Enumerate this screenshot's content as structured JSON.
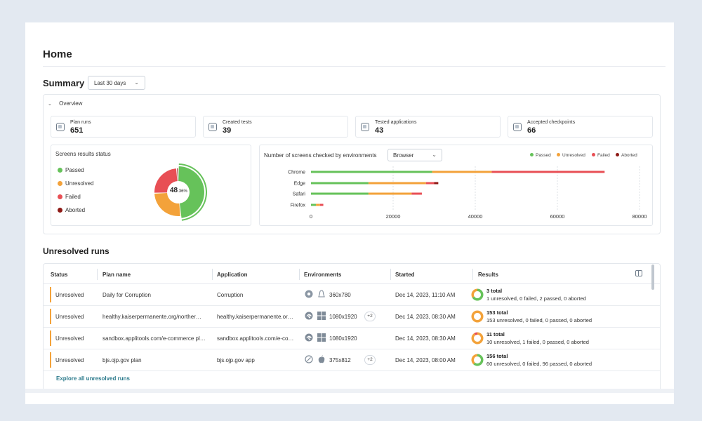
{
  "page": {
    "title": "Home"
  },
  "summary": {
    "title": "Summary",
    "range": "Last 30 days",
    "overview_label": "Overview",
    "stats": [
      {
        "label": "Plan runs",
        "value": "651",
        "icon": "plan-runs-icon"
      },
      {
        "label": "Created tests",
        "value": "39",
        "icon": "tests-icon"
      },
      {
        "label": "Tested applications",
        "value": "43",
        "icon": "grid-icon"
      },
      {
        "label": "Accepted checkpoints",
        "value": "66",
        "icon": "checkpoint-icon"
      }
    ],
    "screens_status": {
      "title": "Screens results status",
      "legend": [
        {
          "label": "Passed",
          "color": "#66c25a"
        },
        {
          "label": "Unresolved",
          "color": "#f3a23a"
        },
        {
          "label": "Failed",
          "color": "#e84f55"
        },
        {
          "label": "Aborted",
          "color": "#8e1a16"
        }
      ],
      "center_value": "48",
      "center_decimal": ".36%",
      "donut": [
        {
          "status": "Passed",
          "fraction": 0.4836
        },
        {
          "status": "Unresolved",
          "fraction": 0.26
        },
        {
          "status": "Failed",
          "fraction": 0.245
        },
        {
          "status": "Aborted",
          "fraction": 0.0114
        }
      ]
    },
    "environments": {
      "title": "Number of screens checked by environments",
      "filter": "Browser",
      "legend": [
        {
          "label": "Passed",
          "color": "#66c25a"
        },
        {
          "label": "Unresolved",
          "color": "#f3a23a"
        },
        {
          "label": "Failed",
          "color": "#e84f55"
        },
        {
          "label": "Aborted",
          "color": "#8e1a16"
        }
      ]
    }
  },
  "chart_data": {
    "type": "bar",
    "orientation": "horizontal",
    "stacked": true,
    "categories": [
      "Chrome",
      "Edge",
      "Safari",
      "Firefox"
    ],
    "series": [
      {
        "name": "Passed",
        "color": "#66c25a",
        "values": [
          29500,
          14000,
          14000,
          1200
        ]
      },
      {
        "name": "Unresolved",
        "color": "#f3a23a",
        "values": [
          14500,
          14000,
          10500,
          1000
        ]
      },
      {
        "name": "Failed",
        "color": "#e84f55",
        "values": [
          27500,
          2000,
          2500,
          800
        ]
      },
      {
        "name": "Aborted",
        "color": "#8e1a16",
        "values": [
          0,
          1000,
          0,
          0
        ]
      }
    ],
    "xlim": [
      0,
      80000
    ],
    "xticks": [
      "0",
      "20000",
      "40000",
      "60000",
      "80000"
    ],
    "grid": true,
    "legend": "top-right"
  },
  "unresolved": {
    "title": "Unresolved runs",
    "columns": [
      "Status",
      "Plan name",
      "Application",
      "Environments",
      "Started",
      "Results"
    ],
    "rows": [
      {
        "status": "Unresolved",
        "plan": "Daily for Corruption",
        "app": "Corruption",
        "env_icons": [
          "chrome-icon",
          "linux-icon"
        ],
        "resolution": "360x780",
        "extra": "",
        "started": "Dec 14, 2023, 11:10 AM",
        "total": "3 total",
        "detail": "1 unresolved, 0 failed, 2 passed, 0 aborted",
        "ring": {
          "passed": 2,
          "unresolved": 1,
          "failed": 0,
          "aborted": 0
        }
      },
      {
        "status": "Unresolved",
        "plan": "healthy.kaiserpermanente.org/norther…",
        "app": "healthy.kaiserpermanente.or…",
        "env_icons": [
          "edge-icon",
          "windows-icon"
        ],
        "resolution": "1080x1920",
        "extra": "+2",
        "started": "Dec 14, 2023, 08:30 AM",
        "total": "153 total",
        "detail": "153 unresolved, 0 failed, 0 passed, 0 aborted",
        "ring": {
          "passed": 0,
          "unresolved": 153,
          "failed": 0,
          "aborted": 0
        }
      },
      {
        "status": "Unresolved",
        "plan": "sandbox.applitools.com/e-commerce pl…",
        "app": "sandbox.applitools.com/e-co…",
        "env_icons": [
          "edge-icon",
          "windows-icon"
        ],
        "resolution": "1080x1920",
        "extra": "",
        "started": "Dec 14, 2023, 08:30 AM",
        "total": "11 total",
        "detail": "10 unresolved, 1 failed, 0 passed, 0 aborted",
        "ring": {
          "passed": 0,
          "unresolved": 10,
          "failed": 1,
          "aborted": 0
        }
      },
      {
        "status": "Unresolved",
        "plan": "bjs.ojp.gov plan",
        "app": "bjs.ojp.gov app",
        "env_icons": [
          "safari-icon",
          "apple-icon"
        ],
        "resolution": "375x812",
        "extra": "+2",
        "started": "Dec 14, 2023, 08:00 AM",
        "total": "156 total",
        "detail": "60 unresolved, 0 failed, 96 passed, 0 aborted",
        "ring": {
          "passed": 96,
          "unresolved": 60,
          "failed": 0,
          "aborted": 0
        }
      }
    ],
    "explore_link": "Explore all unresolved runs"
  }
}
